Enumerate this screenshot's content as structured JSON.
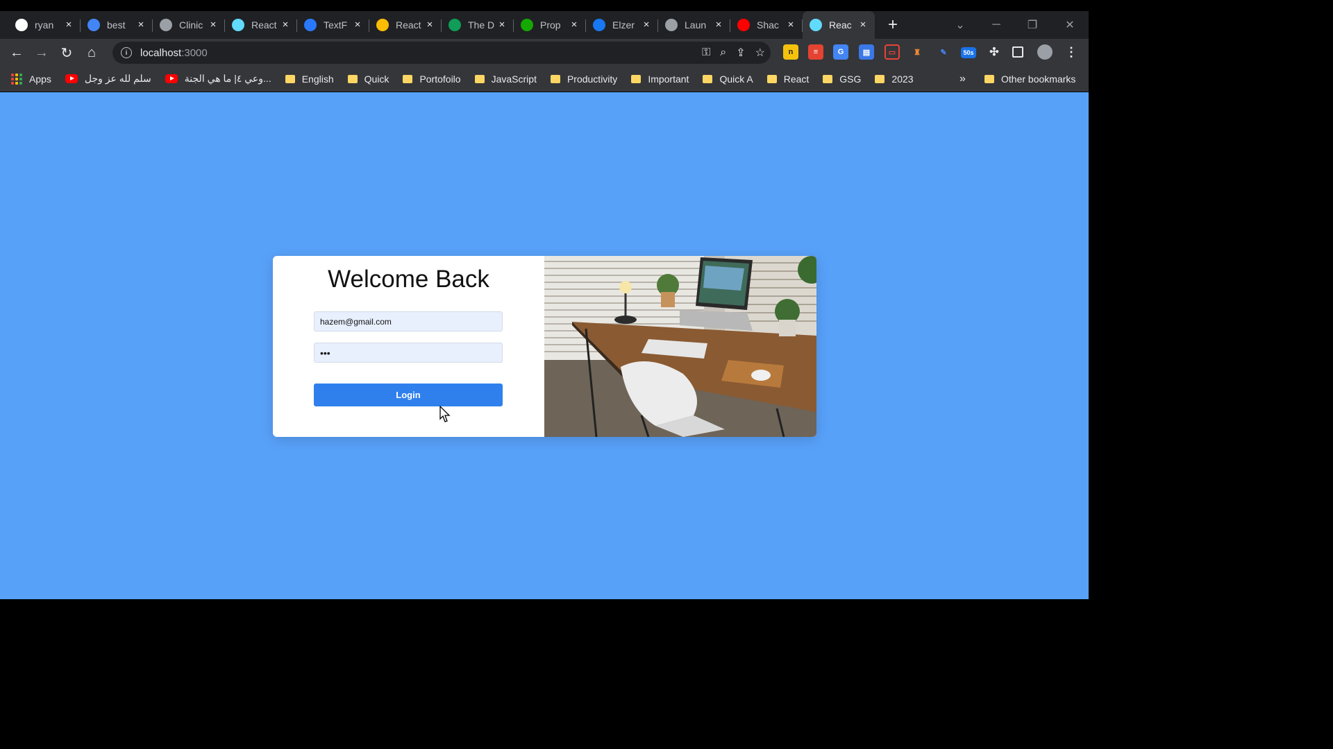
{
  "tabs": [
    {
      "title": "ryan",
      "icon": "github-icon",
      "color": "#ffffff"
    },
    {
      "title": "best",
      "icon": "google-icon",
      "color": "#4285f4"
    },
    {
      "title": "Clinic",
      "icon": "globe-icon",
      "color": "#9aa0a6"
    },
    {
      "title": "React",
      "icon": "react-icon",
      "color": "#61dafb"
    },
    {
      "title": "TextF",
      "icon": "mui-icon",
      "color": "#2979ff"
    },
    {
      "title": "React",
      "icon": "google-drive-icon",
      "color": "#fbbc04"
    },
    {
      "title": "The D",
      "icon": "sheets-icon",
      "color": "#0f9d58"
    },
    {
      "title": "Prop",
      "icon": "upwork-icon",
      "color": "#14a800"
    },
    {
      "title": "Elzer",
      "icon": "facebook-icon",
      "color": "#1877f2"
    },
    {
      "title": "Laun",
      "icon": "globe-icon",
      "color": "#9aa0a6"
    },
    {
      "title": "Shac",
      "icon": "youtube-icon",
      "color": "#ff0000"
    },
    {
      "title": "Reac",
      "icon": "react-icon",
      "color": "#61dafb",
      "active": true
    }
  ],
  "address": {
    "host": "localhost",
    "port": ":3000"
  },
  "bookmarks": {
    "apps": "Apps",
    "items": [
      {
        "label": "سلم لله عز وجل",
        "type": "youtube"
      },
      {
        "label": "وعي ٤| ما هي الجنة...",
        "type": "youtube"
      },
      {
        "label": "English",
        "type": "folder"
      },
      {
        "label": "Quick",
        "type": "folder"
      },
      {
        "label": "Portofoilo",
        "type": "folder"
      },
      {
        "label": "JavaScript",
        "type": "folder"
      },
      {
        "label": "Productivity",
        "type": "folder"
      },
      {
        "label": "Important",
        "type": "folder"
      },
      {
        "label": "Quick A",
        "type": "folder"
      },
      {
        "label": "React",
        "type": "folder"
      },
      {
        "label": "GSG",
        "type": "folder"
      },
      {
        "label": "2023",
        "type": "folder"
      }
    ],
    "overflow": "»",
    "other": "Other bookmarks"
  },
  "extensions": {
    "badge": "50s"
  },
  "login": {
    "heading": "Welcome Back",
    "email_value": "hazem@gmail.com",
    "password_value": "•••",
    "button_label": "Login"
  },
  "colors": {
    "page_bg": "#58a1f9",
    "button": "#2f80ed",
    "input_bg": "#e8f0fe"
  }
}
